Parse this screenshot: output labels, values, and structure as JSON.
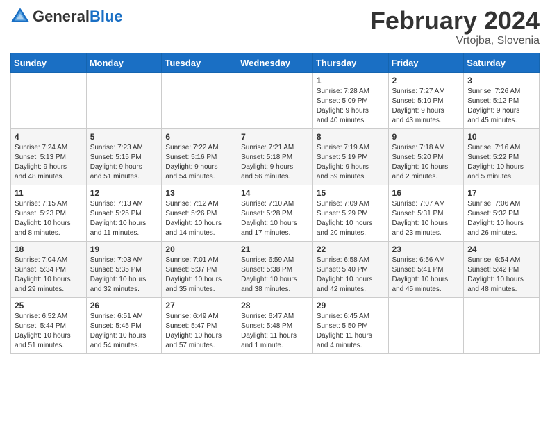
{
  "header": {
    "logo": {
      "general": "General",
      "blue": "Blue"
    },
    "title": "February 2024",
    "location": "Vrtojba, Slovenia"
  },
  "calendar": {
    "days_of_week": [
      "Sunday",
      "Monday",
      "Tuesday",
      "Wednesday",
      "Thursday",
      "Friday",
      "Saturday"
    ],
    "weeks": [
      [
        {
          "day": "",
          "info": ""
        },
        {
          "day": "",
          "info": ""
        },
        {
          "day": "",
          "info": ""
        },
        {
          "day": "",
          "info": ""
        },
        {
          "day": "1",
          "info": "Sunrise: 7:28 AM\nSunset: 5:09 PM\nDaylight: 9 hours\nand 40 minutes."
        },
        {
          "day": "2",
          "info": "Sunrise: 7:27 AM\nSunset: 5:10 PM\nDaylight: 9 hours\nand 43 minutes."
        },
        {
          "day": "3",
          "info": "Sunrise: 7:26 AM\nSunset: 5:12 PM\nDaylight: 9 hours\nand 45 minutes."
        }
      ],
      [
        {
          "day": "4",
          "info": "Sunrise: 7:24 AM\nSunset: 5:13 PM\nDaylight: 9 hours\nand 48 minutes."
        },
        {
          "day": "5",
          "info": "Sunrise: 7:23 AM\nSunset: 5:15 PM\nDaylight: 9 hours\nand 51 minutes."
        },
        {
          "day": "6",
          "info": "Sunrise: 7:22 AM\nSunset: 5:16 PM\nDaylight: 9 hours\nand 54 minutes."
        },
        {
          "day": "7",
          "info": "Sunrise: 7:21 AM\nSunset: 5:18 PM\nDaylight: 9 hours\nand 56 minutes."
        },
        {
          "day": "8",
          "info": "Sunrise: 7:19 AM\nSunset: 5:19 PM\nDaylight: 9 hours\nand 59 minutes."
        },
        {
          "day": "9",
          "info": "Sunrise: 7:18 AM\nSunset: 5:20 PM\nDaylight: 10 hours\nand 2 minutes."
        },
        {
          "day": "10",
          "info": "Sunrise: 7:16 AM\nSunset: 5:22 PM\nDaylight: 10 hours\nand 5 minutes."
        }
      ],
      [
        {
          "day": "11",
          "info": "Sunrise: 7:15 AM\nSunset: 5:23 PM\nDaylight: 10 hours\nand 8 minutes."
        },
        {
          "day": "12",
          "info": "Sunrise: 7:13 AM\nSunset: 5:25 PM\nDaylight: 10 hours\nand 11 minutes."
        },
        {
          "day": "13",
          "info": "Sunrise: 7:12 AM\nSunset: 5:26 PM\nDaylight: 10 hours\nand 14 minutes."
        },
        {
          "day": "14",
          "info": "Sunrise: 7:10 AM\nSunset: 5:28 PM\nDaylight: 10 hours\nand 17 minutes."
        },
        {
          "day": "15",
          "info": "Sunrise: 7:09 AM\nSunset: 5:29 PM\nDaylight: 10 hours\nand 20 minutes."
        },
        {
          "day": "16",
          "info": "Sunrise: 7:07 AM\nSunset: 5:31 PM\nDaylight: 10 hours\nand 23 minutes."
        },
        {
          "day": "17",
          "info": "Sunrise: 7:06 AM\nSunset: 5:32 PM\nDaylight: 10 hours\nand 26 minutes."
        }
      ],
      [
        {
          "day": "18",
          "info": "Sunrise: 7:04 AM\nSunset: 5:34 PM\nDaylight: 10 hours\nand 29 minutes."
        },
        {
          "day": "19",
          "info": "Sunrise: 7:03 AM\nSunset: 5:35 PM\nDaylight: 10 hours\nand 32 minutes."
        },
        {
          "day": "20",
          "info": "Sunrise: 7:01 AM\nSunset: 5:37 PM\nDaylight: 10 hours\nand 35 minutes."
        },
        {
          "day": "21",
          "info": "Sunrise: 6:59 AM\nSunset: 5:38 PM\nDaylight: 10 hours\nand 38 minutes."
        },
        {
          "day": "22",
          "info": "Sunrise: 6:58 AM\nSunset: 5:40 PM\nDaylight: 10 hours\nand 42 minutes."
        },
        {
          "day": "23",
          "info": "Sunrise: 6:56 AM\nSunset: 5:41 PM\nDaylight: 10 hours\nand 45 minutes."
        },
        {
          "day": "24",
          "info": "Sunrise: 6:54 AM\nSunset: 5:42 PM\nDaylight: 10 hours\nand 48 minutes."
        }
      ],
      [
        {
          "day": "25",
          "info": "Sunrise: 6:52 AM\nSunset: 5:44 PM\nDaylight: 10 hours\nand 51 minutes."
        },
        {
          "day": "26",
          "info": "Sunrise: 6:51 AM\nSunset: 5:45 PM\nDaylight: 10 hours\nand 54 minutes."
        },
        {
          "day": "27",
          "info": "Sunrise: 6:49 AM\nSunset: 5:47 PM\nDaylight: 10 hours\nand 57 minutes."
        },
        {
          "day": "28",
          "info": "Sunrise: 6:47 AM\nSunset: 5:48 PM\nDaylight: 11 hours\nand 1 minute."
        },
        {
          "day": "29",
          "info": "Sunrise: 6:45 AM\nSunset: 5:50 PM\nDaylight: 11 hours\nand 4 minutes."
        },
        {
          "day": "",
          "info": ""
        },
        {
          "day": "",
          "info": ""
        }
      ]
    ]
  }
}
